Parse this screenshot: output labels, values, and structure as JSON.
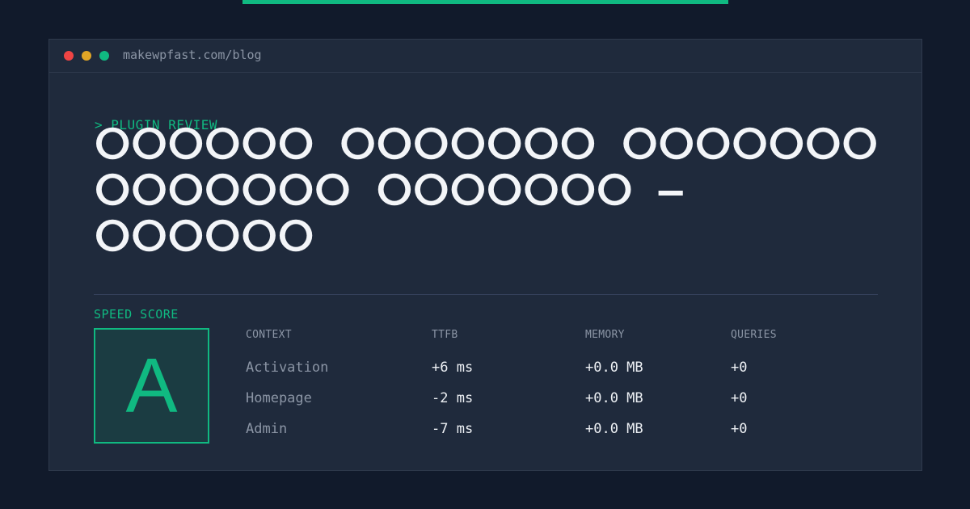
{
  "header": {
    "url": "makewpfast.com/blog"
  },
  "article": {
    "eyebrow": "> PLUGIN REVIEW",
    "title_line_1": "ⵔⵔⵔⵔⵔⵔ ⵔⵔⵔⵔⵔⵔⵔ ⵔⵔⵔⵔⵔⵔⵔ",
    "title_line_2": "ⵔⵔⵔⵔⵔⵔⵔ ⵔⵔⵔⵔⵔⵔⵔ — ⵔⵔⵔⵔⵔⵔ"
  },
  "score": {
    "label": "SPEED SCORE",
    "grade": "A"
  },
  "table": {
    "headers": [
      "CONTEXT",
      "TTFB",
      "MEMORY",
      "QUERIES"
    ],
    "rows": [
      {
        "context": "Activation",
        "ttfb": "+6 ms",
        "memory": "+0.0 MB",
        "queries": "+0"
      },
      {
        "context": "Homepage",
        "ttfb": "-2 ms",
        "memory": "+0.0 MB",
        "queries": "+0"
      },
      {
        "context": "Admin",
        "ttfb": "-7 ms",
        "memory": "+0.0 MB",
        "queries": "+0"
      }
    ]
  },
  "colors": {
    "accent": "#10b981",
    "background": "#111a2b",
    "card": "#1f2a3c"
  }
}
